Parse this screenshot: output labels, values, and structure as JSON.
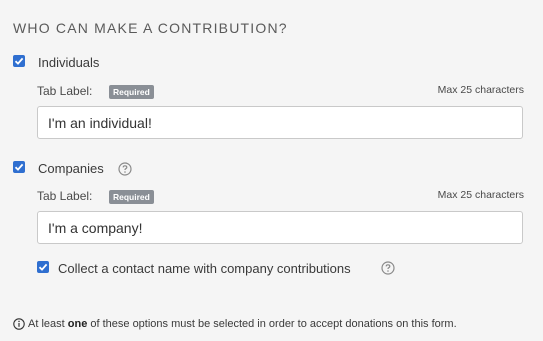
{
  "section": {
    "title": "WHO CAN MAKE A CONTRIBUTION?"
  },
  "individuals": {
    "checkbox_checked": true,
    "label": "Individuals",
    "tab_label": "Tab Label:",
    "required_badge": "Required",
    "max_chars": "Max 25 characters",
    "input_value": "I'm an individual!"
  },
  "companies": {
    "checkbox_checked": true,
    "label": "Companies",
    "help_icon": "question-circle-icon",
    "tab_label": "Tab Label:",
    "required_badge": "Required",
    "max_chars": "Max 25 characters",
    "input_value": "I'm a company!",
    "contact": {
      "checkbox_checked": true,
      "label": "Collect a contact name with company contributions",
      "help_icon": "question-circle-icon"
    }
  },
  "footer": {
    "icon": "info-circle-icon",
    "text_before": "At least ",
    "emphasis": "one",
    "text_after": " of these options must be selected in order to accept donations on this form."
  },
  "colors": {
    "checkbox": "#2f6fd0",
    "badge": "#8a8f96",
    "background": "#f5f5f5"
  }
}
